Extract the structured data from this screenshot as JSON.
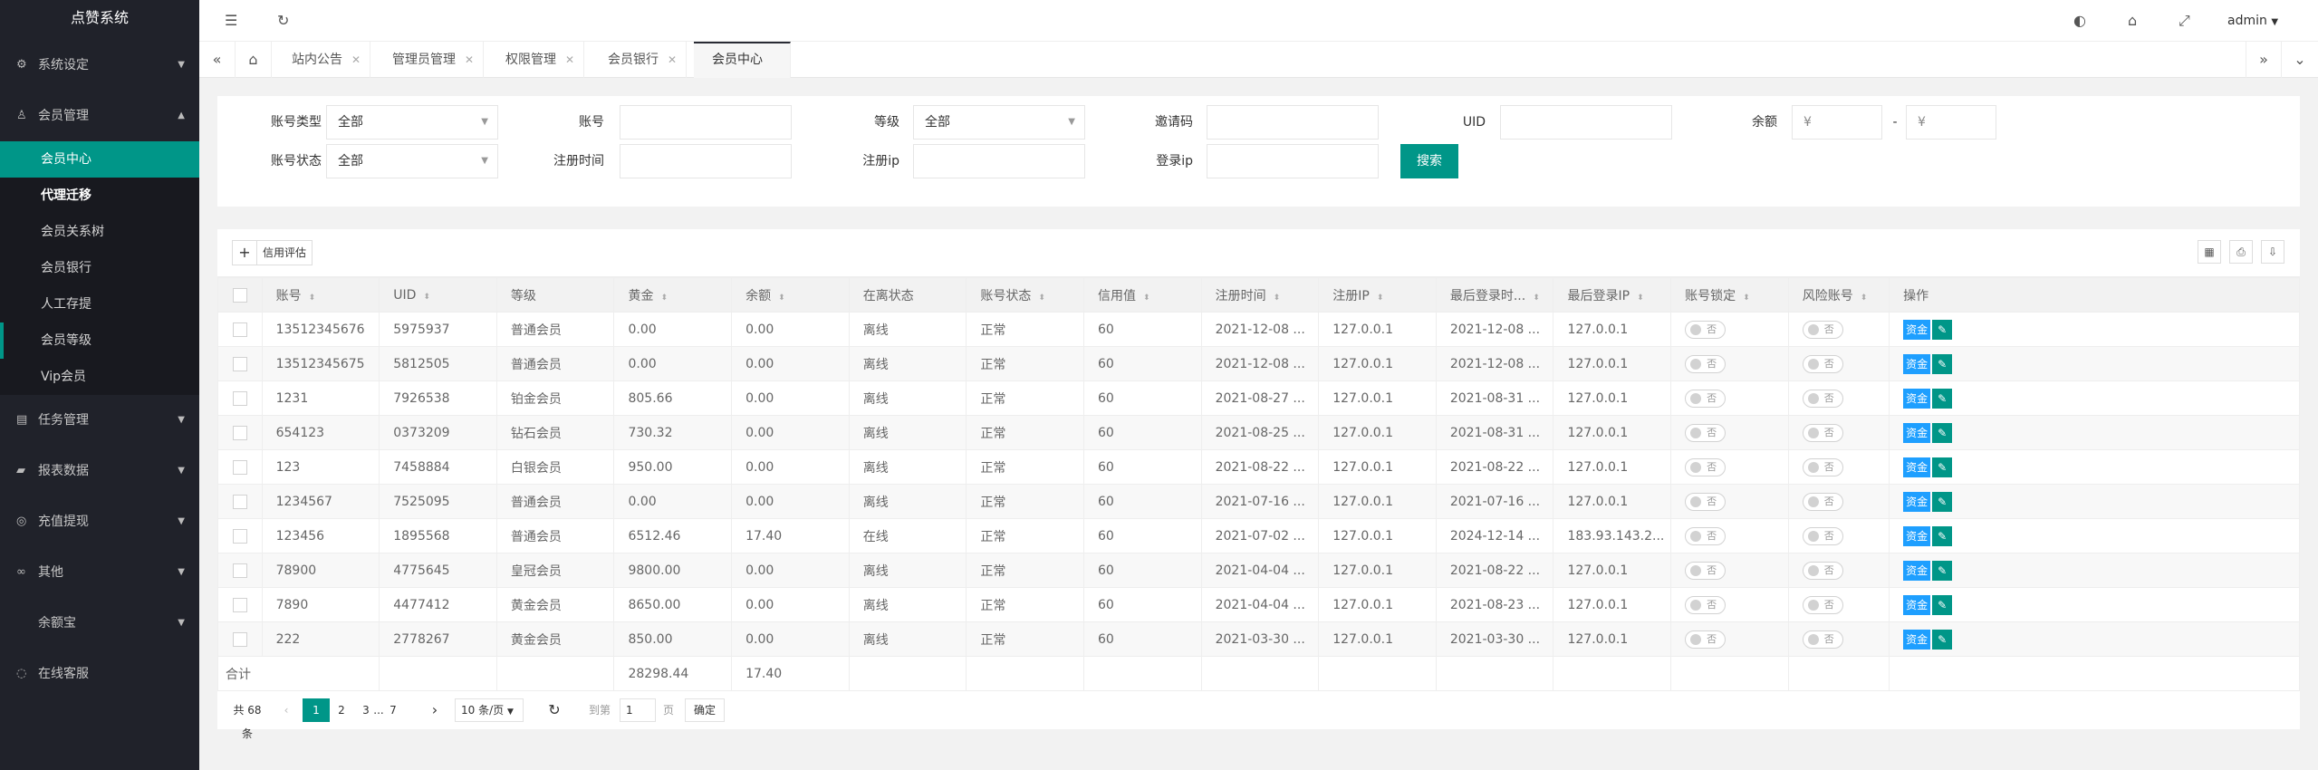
{
  "sidebar": {
    "logo": "点赞系统",
    "groups": [
      {
        "label": "系统设定",
        "icon": "gear-icon"
      },
      {
        "label": "会员管理",
        "icon": "user-icon"
      },
      {
        "label": "任务管理",
        "icon": "task-icon"
      },
      {
        "label": "报表数据",
        "icon": "report-icon"
      },
      {
        "label": "充值提现",
        "icon": "money-icon"
      },
      {
        "label": "其他",
        "icon": "link-icon"
      },
      {
        "label": "余额宝",
        "icon": ""
      },
      {
        "label": "在线客服",
        "icon": "support-icon"
      }
    ],
    "sub_items": [
      "会员中心",
      "代理迁移",
      "会员关系树",
      "会员银行",
      "人工存提",
      "会员等级",
      "Vip会员"
    ]
  },
  "header": {
    "user": "admin"
  },
  "tabs": [
    "站内公告",
    "管理员管理",
    "权限管理",
    "会员银行",
    "会员中心"
  ],
  "search": {
    "account_type_label": "账号类型",
    "account_type_value": "全部",
    "account_label": "账号",
    "level_label": "等级",
    "level_value": "全部",
    "invite_label": "邀请码",
    "uid_label": "UID",
    "balance_label": "余额",
    "currency": "¥",
    "dash": "-",
    "status_label": "账号状态",
    "status_value": "全部",
    "regtime_label": "注册时间",
    "regip_label": "注册ip",
    "loginip_label": "登录ip",
    "search_button": "搜索"
  },
  "toolbar": {
    "add": "+",
    "credit": "信用评估"
  },
  "table": {
    "columns": [
      "账号",
      "UID",
      "等级",
      "黄金",
      "余额",
      "在离状态",
      "账号状态",
      "信用值",
      "注册时间",
      "注册IP",
      "最后登录时...",
      "最后登录IP",
      "账号锁定",
      "风险账号",
      "操作"
    ],
    "rows": [
      [
        "13512345676",
        "5975937",
        "普通会员",
        "0.00",
        "0.00",
        "离线",
        "正常",
        "60",
        "2021-12-08 ...",
        "127.0.0.1",
        "2021-12-08 ...",
        "127.0.0.1"
      ],
      [
        "13512345675",
        "5812505",
        "普通会员",
        "0.00",
        "0.00",
        "离线",
        "正常",
        "60",
        "2021-12-08 ...",
        "127.0.0.1",
        "2021-12-08 ...",
        "127.0.0.1"
      ],
      [
        "1231",
        "7926538",
        "铂金会员",
        "805.66",
        "0.00",
        "离线",
        "正常",
        "60",
        "2021-08-27 ...",
        "127.0.0.1",
        "2021-08-31 ...",
        "127.0.0.1"
      ],
      [
        "654123",
        "0373209",
        "钻石会员",
        "730.32",
        "0.00",
        "离线",
        "正常",
        "60",
        "2021-08-25 ...",
        "127.0.0.1",
        "2021-08-31 ...",
        "127.0.0.1"
      ],
      [
        "123",
        "7458884",
        "白银会员",
        "950.00",
        "0.00",
        "离线",
        "正常",
        "60",
        "2021-08-22 ...",
        "127.0.0.1",
        "2021-08-22 ...",
        "127.0.0.1"
      ],
      [
        "1234567",
        "7525095",
        "普通会员",
        "0.00",
        "0.00",
        "离线",
        "正常",
        "60",
        "2021-07-16 ...",
        "127.0.0.1",
        "2021-07-16 ...",
        "127.0.0.1"
      ],
      [
        "123456",
        "1895568",
        "普通会员",
        "6512.46",
        "17.40",
        "在线",
        "正常",
        "60",
        "2021-07-02 ...",
        "127.0.0.1",
        "2024-12-14 ...",
        "183.93.143.2..."
      ],
      [
        "78900",
        "4775645",
        "皇冠会员",
        "9800.00",
        "0.00",
        "离线",
        "正常",
        "60",
        "2021-04-04 ...",
        "127.0.0.1",
        "2021-08-22 ...",
        "127.0.0.1"
      ],
      [
        "7890",
        "4477412",
        "黄金会员",
        "8650.00",
        "0.00",
        "离线",
        "正常",
        "60",
        "2021-04-04 ...",
        "127.0.0.1",
        "2021-08-23 ...",
        "127.0.0.1"
      ],
      [
        "222",
        "2778267",
        "黄金会员",
        "850.00",
        "0.00",
        "离线",
        "正常",
        "60",
        "2021-03-30 ...",
        "127.0.0.1",
        "2021-03-30 ...",
        "127.0.0.1"
      ]
    ],
    "switch_label": "否",
    "fund_label": "资金",
    "edit_icon": "✎",
    "total_label": "合计",
    "total_gold": "28298.44",
    "total_balance": "17.40"
  },
  "pager": {
    "total": "共 68 条",
    "pages": [
      "1",
      "2",
      "3",
      "...",
      "7"
    ],
    "per_page": "10 条/页",
    "goto": "到第",
    "page_input": "1",
    "page_unit": "页",
    "confirm": "确定"
  }
}
